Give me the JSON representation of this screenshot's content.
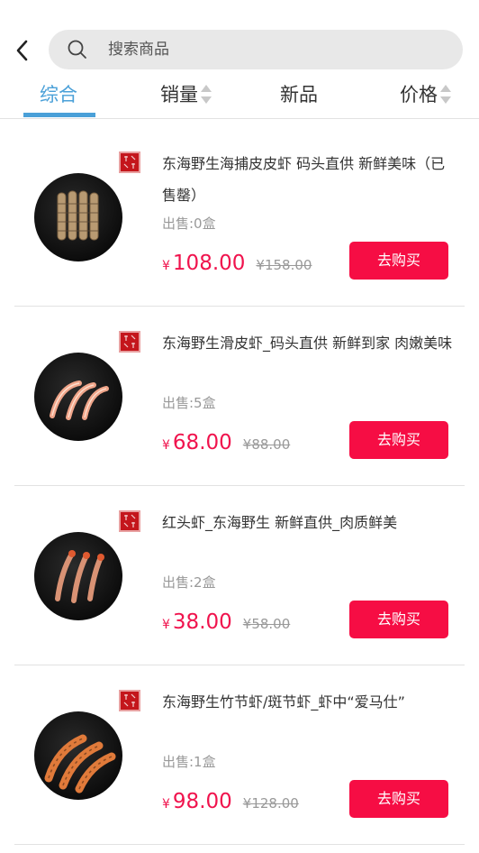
{
  "header": {
    "search_placeholder": "搜索商品"
  },
  "sort_tabs": [
    {
      "label": "综合"
    },
    {
      "label": "销量"
    },
    {
      "label": "新品"
    },
    {
      "label": "价格"
    }
  ],
  "products": [
    {
      "title": "东海野生海捕皮皮虾 码头直供 新鲜美味（已售罄）",
      "sold": "出售:0盒",
      "currency": "¥",
      "price": "108.00",
      "old_price": "¥158.00",
      "buy_label": "去购买"
    },
    {
      "title": "东海野生滑皮虾_码头直供 新鲜到家 肉嫩美味",
      "sold": "出售:5盒",
      "currency": "¥",
      "price": "68.00",
      "old_price": "¥88.00",
      "buy_label": "去购买"
    },
    {
      "title": "红头虾_东海野生 新鲜直供_肉质鲜美",
      "sold": "出售:2盒",
      "currency": "¥",
      "price": "38.00",
      "old_price": "¥58.00",
      "buy_label": "去购买"
    },
    {
      "title": "东海野生竹节虾/斑节虾_虾中“爱马仕”",
      "sold": "出售:1盒",
      "currency": "¥",
      "price": "98.00",
      "old_price": "¥128.00",
      "buy_label": "去购买"
    }
  ],
  "colors": {
    "accent_blue": "#4aa0d8",
    "price_red": "#f0134d",
    "button_red": "#f60d44",
    "seal_red": "#c4161c"
  },
  "icons": [
    "back-arrow-icon",
    "search-icon",
    "sort-arrows-icon",
    "brand-seal-icon"
  ]
}
